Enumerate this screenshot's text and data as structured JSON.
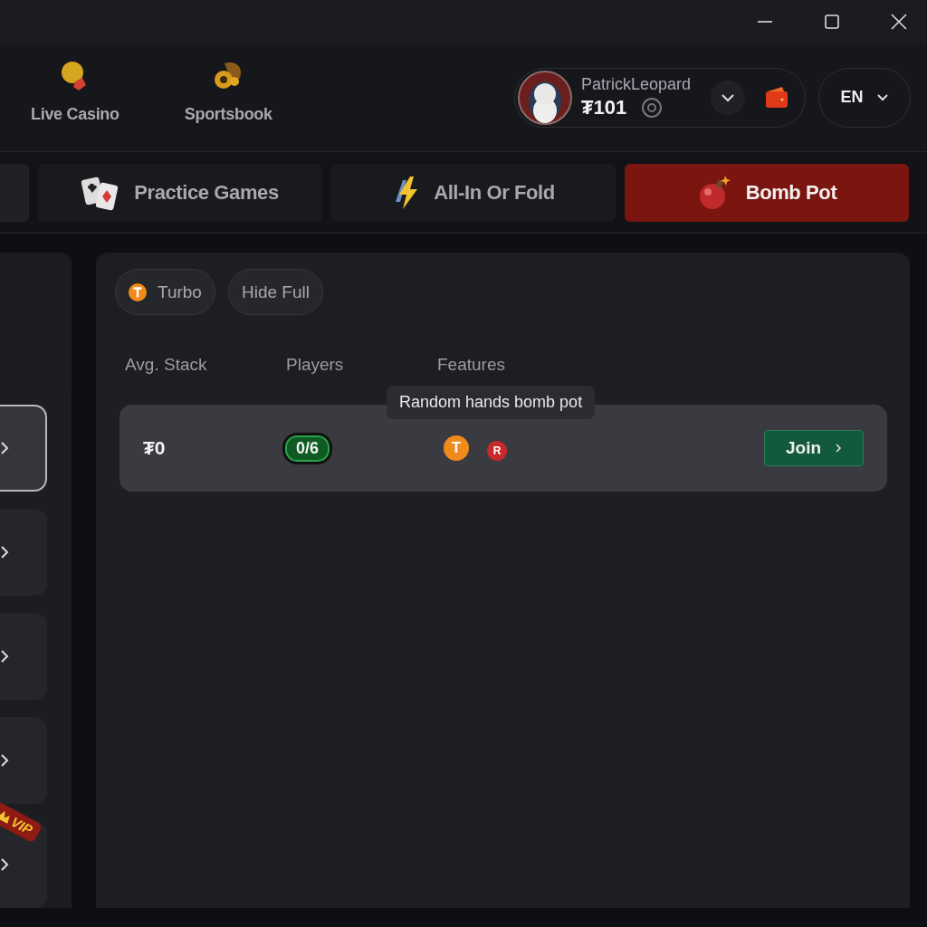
{
  "nav": [
    {
      "label": "Live Casino",
      "kind": "casino"
    },
    {
      "label": "Sportsbook",
      "kind": "sports"
    }
  ],
  "user": {
    "name": "PatrickLeopard",
    "balance": "₮101"
  },
  "language": "EN",
  "tabs": [
    {
      "label": "Practice Games",
      "kind": "cards",
      "selected": false
    },
    {
      "label": "All-In Or Fold",
      "kind": "bolt",
      "selected": false
    },
    {
      "label": "Bomb Pot",
      "kind": "bomb",
      "selected": true
    }
  ],
  "side_list": [
    {
      "selected": true
    },
    {
      "selected": false
    },
    {
      "selected": false
    },
    {
      "selected": false
    },
    {
      "selected": false,
      "badge": "VIP"
    }
  ],
  "filters": [
    {
      "label": "Turbo",
      "kind": "turbo"
    },
    {
      "label": "Hide Full",
      "kind": "plain"
    }
  ],
  "columns": [
    "Avg. Stack",
    "Players",
    "Features"
  ],
  "tooltip": "Random hands bomb pot",
  "rows": [
    {
      "avg_stack": "₮0",
      "players": "0/6",
      "features": [
        {
          "kind": "turbo",
          "label": "T"
        },
        {
          "kind": "bomb",
          "label": "R"
        }
      ],
      "action": "Join"
    }
  ]
}
